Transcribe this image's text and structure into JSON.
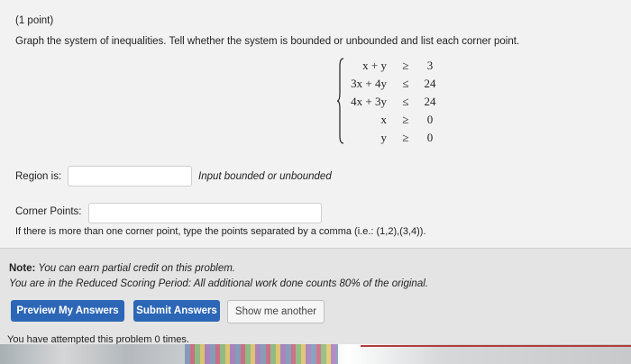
{
  "problem": {
    "points": "(1 point)",
    "prompt": "Graph the system of inequalities. Tell whether the system is bounded or unbounded and list each corner point."
  },
  "system": [
    {
      "lhs": "x + y",
      "rel": "≥",
      "rhs": "3"
    },
    {
      "lhs": "3x + 4y",
      "rel": "≤",
      "rhs": "24"
    },
    {
      "lhs": "4x + 3y",
      "rel": "≤",
      "rhs": "24"
    },
    {
      "lhs": "x",
      "rel": "≥",
      "rhs": "0"
    },
    {
      "lhs": "y",
      "rel": "≥",
      "rhs": "0"
    }
  ],
  "region": {
    "label": "Region is:",
    "value": "",
    "hint": "Input bounded or unbounded"
  },
  "corners": {
    "label": "Corner Points:",
    "value": "",
    "note": "If there is more than one corner point, type the points separated by a comma (i.e.: (1,2),(3,4))."
  },
  "notes": {
    "note_label": "Note:",
    "note_text": " You can earn partial credit on this problem.",
    "reduced": "You are in the Reduced Scoring Period: All additional work done counts 80% of the original."
  },
  "buttons": {
    "preview": "Preview My Answers",
    "submit": "Submit Answers",
    "another": "Show me another"
  },
  "status": {
    "attempted": "You have attempted this problem 0 times."
  }
}
